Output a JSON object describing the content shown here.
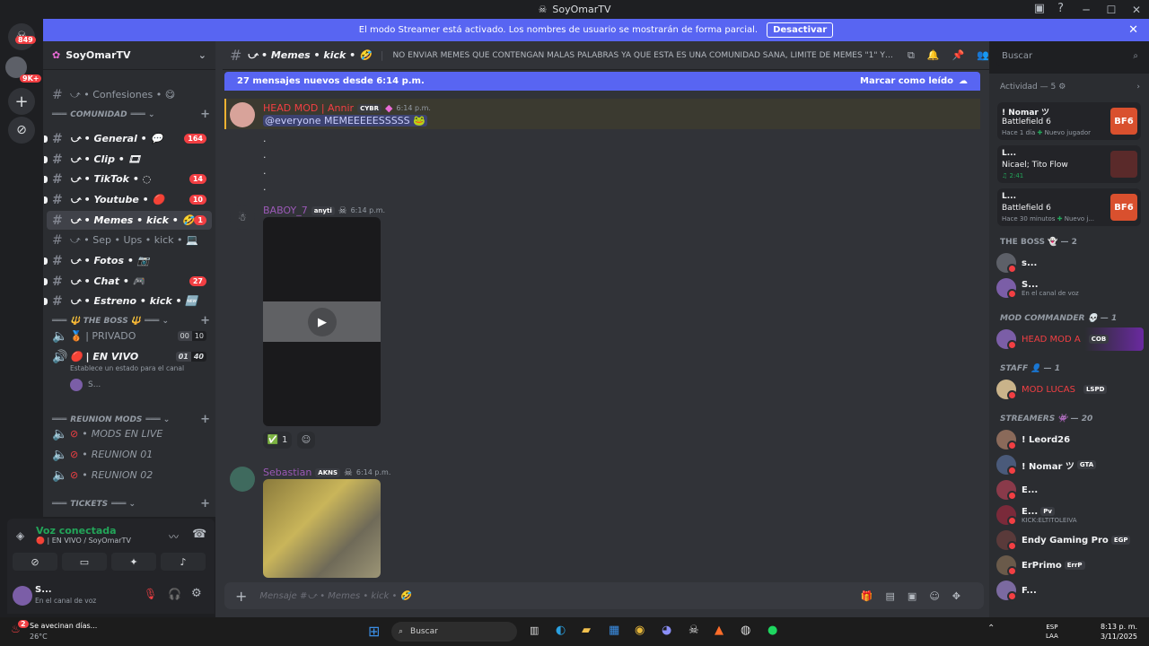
{
  "window": {
    "title": "SoyOmarTV"
  },
  "banner": {
    "text": "El modo Streamer está activado. Los nombres de usuario se mostrarán de forma parcial.",
    "button": "Desactivar"
  },
  "rail": {
    "badge_top": "849",
    "badge_mid": "9K+"
  },
  "server": {
    "name": "SoyOmarTV"
  },
  "channels": [
    {
      "name": "⤻ • Confesiones • 😋",
      "bold": false,
      "count": ""
    },
    {
      "name": "⤻ • General • 💬",
      "bold": true,
      "count": "164"
    },
    {
      "name": "⤻ • Clip • 🎞",
      "bold": true,
      "count": ""
    },
    {
      "name": "⤻ • TikTok • ◌",
      "bold": true,
      "count": "14"
    },
    {
      "name": "⤻ • Youtube • 🔴",
      "bold": true,
      "count": "10"
    },
    {
      "name": "⤻ • Memes • kick • 🤣",
      "bold": true,
      "count": "1"
    },
    {
      "name": "⤻ • Sep • Ups • kick • 💻",
      "bold": false,
      "count": ""
    },
    {
      "name": "⤻ • Fotos • 📷",
      "bold": true,
      "count": ""
    },
    {
      "name": "⤻ • Chat • 🎮",
      "bold": true,
      "count": "27"
    },
    {
      "name": "⤻ • Estreno • kick • 🆕",
      "bold": true,
      "count": ""
    }
  ],
  "categories": {
    "comunidad": "COMUNIDAD",
    "boss": "🔱 THE BOSS 🔱",
    "reunion": "REUNION MODS",
    "tickets": "TICKETS"
  },
  "voice": [
    {
      "name": "🥉 | PRIVADO",
      "a": "00",
      "b": "10"
    },
    {
      "name": "🔴 | EN VIVO",
      "a": "01",
      "b": "40"
    }
  ],
  "voice_status_hint": "Establece un estado para el canal",
  "voice_user": "S...",
  "reunion": [
    "MODS EN LIVE",
    "REUNION 01",
    "REUNION 02"
  ],
  "voicepanel": {
    "title": "Voz conectada",
    "sub": "🔴 | EN VIVO / SoyOmarTV"
  },
  "userpanel": {
    "name": "S...",
    "status": "En el canal de voz"
  },
  "chat": {
    "channel": "⤻ • Memes • kick • 🤣",
    "topic": "NO ENVIAR MEMES QUE CONTENGAN MALAS PALABRAS YA QUE ESTA ES UNA COMUNIDAD SANA, LIMITE DE MEMES \"1\" Y POR ULTIMO EL ...",
    "new_messages": "27 mensajes nuevos desde 6:14 p.m.",
    "mark_read": "Marcar como leído",
    "placeholder": "Mensaje #⤻ • Memes • kick • 🤣",
    "messages": [
      {
        "author": "HEAD MOD | Annir",
        "tag": "CYBR",
        "time": "6:14 p.m.",
        "text": "@everyone MEMEEEEESSSSS 🐸",
        "dots": [
          ".",
          ".",
          ".",
          "."
        ],
        "color": "#f23f43"
      },
      {
        "author": "BABOY_7",
        "tag": "anyti",
        "time": "6:14 p.m.",
        "reaction": "1",
        "color": "#9b59b6"
      },
      {
        "author": "Sebastian",
        "tag": "AKNS",
        "time": "6:14 p.m.",
        "color": "#9b59b6"
      }
    ]
  },
  "search": {
    "placeholder": "Buscar"
  },
  "activity": {
    "header": "Actividad — 5",
    "cards": [
      {
        "name": "! Nomar ツ",
        "game": "Battlefield 6",
        "meta": "Hace 1 día",
        "extra": "Nuevo jugador",
        "thumb": "BF6"
      },
      {
        "name": "L...",
        "game": "Nicael; Tito Flow",
        "meta": "♫ 2:41",
        "extra": "",
        "thumb": ""
      },
      {
        "name": "L...",
        "game": "Battlefield 6",
        "meta": "Hace 30 minutos",
        "extra": "Nuevo j...",
        "thumb": "BF6"
      }
    ]
  },
  "members": {
    "boss": "THE BOSS 👻 — 2",
    "mod": "MOD COMMANDER 💀 — 1",
    "staff": "STAFF 👤 — 1",
    "streamers": "STREAMERS 👾 — 20",
    "boss_list": [
      {
        "name": "s...",
        "sub": ""
      },
      {
        "name": "S...",
        "sub": "En el canal de voz"
      }
    ],
    "mod_list": [
      {
        "name": "HEAD MOD A",
        "tag": "COB"
      }
    ],
    "staff_list": [
      {
        "name": "MOD LUCAS",
        "tag": "LSPD"
      }
    ],
    "streamer_list": [
      {
        "name": "! Leord26",
        "tag": "",
        "sub": ""
      },
      {
        "name": "! Nomar ツ",
        "tag": "GTA",
        "sub": ""
      },
      {
        "name": "E...",
        "tag": "",
        "sub": ""
      },
      {
        "name": "E...",
        "tag": "Pv",
        "sub": "KICK:ELTITOLEIVA"
      },
      {
        "name": "Endy Gaming Pro",
        "tag": "EGP",
        "sub": ""
      },
      {
        "name": "ErPrimo",
        "tag": "ErrP",
        "sub": ""
      },
      {
        "name": "F...",
        "tag": "",
        "sub": ""
      }
    ]
  },
  "taskbar": {
    "weather": "Se avecinan días...",
    "temp": "26°C",
    "search": "Buscar",
    "lang": "ESP",
    "lang2": "LAA",
    "time": "8:13 p. m.",
    "date": "3/11/2025",
    "notif": "2"
  }
}
